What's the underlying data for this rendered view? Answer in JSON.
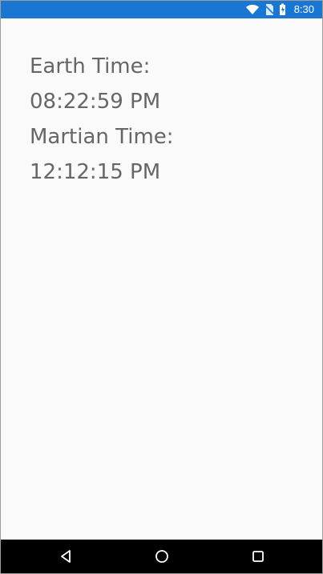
{
  "status_bar": {
    "time": "8:30",
    "icons": [
      "wifi-icon",
      "no-sim-icon",
      "battery-charging-icon"
    ]
  },
  "main": {
    "earth_label": "Earth Time:",
    "earth_time": "08:22:59 PM",
    "martian_label": "Martian Time:",
    "martian_time": "12:12:15 PM"
  },
  "navigation_bar": {
    "icons": [
      "back-icon",
      "home-icon",
      "recent-apps-icon"
    ]
  },
  "colors": {
    "status_bar": "#1976d2",
    "background": "#fafafa",
    "text": "#666666",
    "navigation_bar": "#000000"
  }
}
